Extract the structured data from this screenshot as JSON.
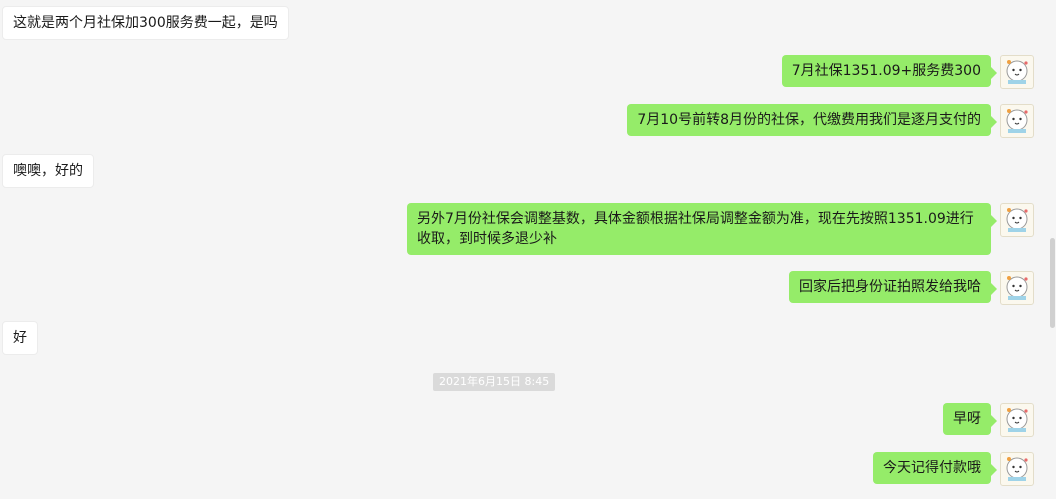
{
  "messages": [
    {
      "side": "in",
      "text": "这就是两个月社保加300服务费一起，是吗"
    },
    {
      "side": "out",
      "text": "7月社保1351.09+服务费300"
    },
    {
      "side": "out",
      "text": "7月10号前转8月份的社保，代缴费用我们是逐月支付的"
    },
    {
      "side": "in",
      "text": "噢噢，好的"
    },
    {
      "side": "out",
      "text": "另外7月份社保会调整基数，具体金额根据社保局调整金额为准，现在先按照1351.09进行收取，到时候多退少补"
    },
    {
      "side": "out",
      "text": "回家后把身份证拍照发给我哈"
    },
    {
      "side": "in",
      "text": "好"
    },
    {
      "side": "out",
      "text": "早呀"
    },
    {
      "side": "out",
      "text": "今天记得付款哦"
    }
  ],
  "timestamp": "2021年6月15日 8:45",
  "colors": {
    "outgoing_bubble": "#95ec69",
    "incoming_bubble": "#ffffff",
    "background": "#f5f5f5"
  },
  "avatar_icon": "cartoon-cat-avatar-icon"
}
